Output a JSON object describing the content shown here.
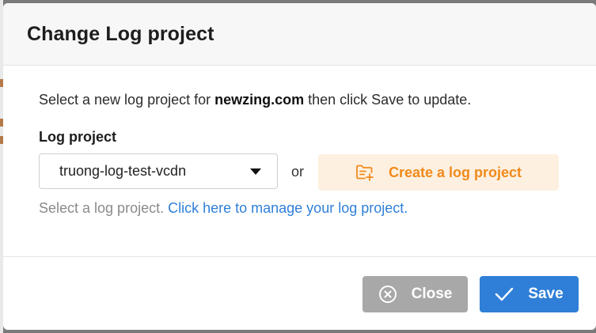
{
  "dialog": {
    "title": "Change Log project",
    "description_prefix": "Select a new log project for ",
    "domain": "newzing.com",
    "description_suffix": " then click Save to update."
  },
  "field": {
    "label": "Log project",
    "selected_value": "truong-log-test-vcdn"
  },
  "or_text": "or",
  "create_button": {
    "label": "Create a log project",
    "icon": "folder-plus-icon"
  },
  "hint": {
    "text": "Select a log project. ",
    "link": "Click here to manage your log project."
  },
  "buttons": {
    "close": {
      "label": "Close",
      "icon": "close-circle-icon"
    },
    "save": {
      "label": "Save",
      "icon": "check-icon"
    }
  },
  "colors": {
    "accent": "#2f7fd8",
    "orange": "#f08a1c",
    "orange_bg": "#fdf0e0",
    "close_bg": "#a8a8a8"
  }
}
